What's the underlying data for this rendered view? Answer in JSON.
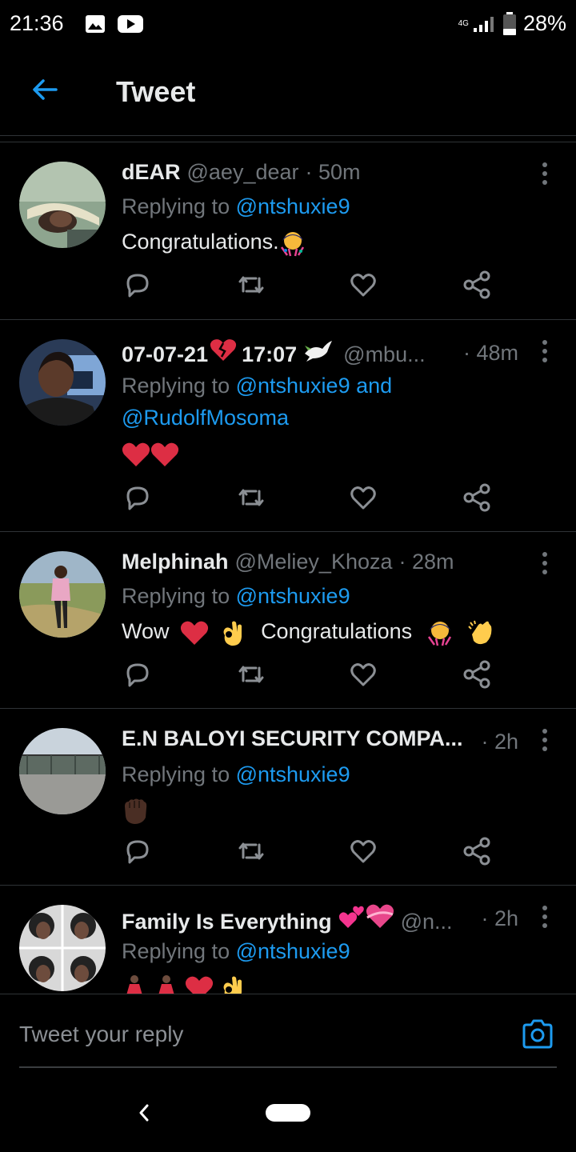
{
  "status_bar": {
    "time": "21:36",
    "network": "4G",
    "battery": "28%",
    "icons": [
      "gallery-icon",
      "youtube-icon",
      "signal-icon",
      "battery-icon"
    ]
  },
  "header": {
    "title": "Tweet",
    "back_icon": "arrow-left-icon"
  },
  "tweets": [
    {
      "name": "dEAR",
      "handle": "@aey_dear",
      "time": "· 50m",
      "replying_prefix": "Replying to ",
      "mentions": "@ntshuxie9",
      "text": "Congratulations.",
      "emojis": [
        "party-person"
      ]
    },
    {
      "name": "07-07-21",
      "name_part2": "17:07",
      "handle": "@mbu...",
      "time": "· 48m",
      "replying_prefix": "Replying to ",
      "mentions": "@ntshuxie9 and",
      "mentions_line2": "@RudolfMosoma",
      "text": "",
      "emojis": [
        "broken-heart",
        "dove",
        "heart",
        "heart"
      ]
    },
    {
      "name": "Melphinah",
      "handle": "@Meliey_Khoza",
      "time": "· 28m",
      "replying_prefix": "Replying to ",
      "mentions": "@ntshuxie9",
      "text_before": "Wow",
      "text_after": "Congratulations",
      "emojis": [
        "heart",
        "ok-hand",
        "party-person",
        "clapping-hands"
      ]
    },
    {
      "name": "E.N BALOYI SECURITY COMPA...",
      "handle": "",
      "time": "· 2h",
      "replying_prefix": "Replying to ",
      "mentions": "@ntshuxie9",
      "text": "",
      "emojis": [
        "raised-fist"
      ]
    },
    {
      "name": "Family Is Everything",
      "handle": "@n...",
      "time": "· 2h",
      "replying_prefix": "Replying to ",
      "mentions": "@ntshuxie9",
      "text": "",
      "emojis": [
        "two-hearts",
        "heart-with-ribbon",
        "dancer",
        "dancer",
        "heart",
        "ok-hand"
      ]
    }
  ],
  "composer": {
    "placeholder": "Tweet your reply",
    "camera_icon": "camera-icon"
  },
  "colors": {
    "background": "#000000",
    "accent": "#1d9bf0",
    "secondary_text": "#71767b",
    "divider": "#2f3336"
  }
}
